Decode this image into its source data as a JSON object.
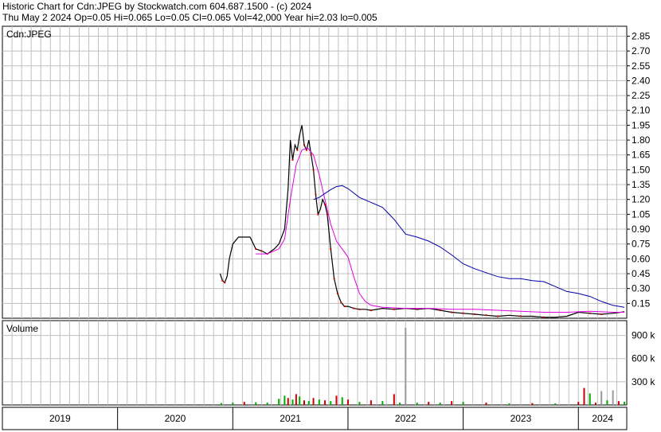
{
  "header": {
    "title_line": "Historic Chart for Cdn:JPEG by Stockwatch.com 604.687.1500 - (c) 2024",
    "quote_line": "Thu May  2 2024  Op=0.05  Hi=0.065  Lo=0.05  Cl=0.065  Vol=42,000  Year hi=2.03  lo=0.005"
  },
  "colors": {
    "price": "#000000",
    "price_down": "#cc0000",
    "ma_short": "#e000e0",
    "ma_long": "#0000aa",
    "volume_up": "#00aa00",
    "volume_down": "#cc0000",
    "volume_neutral": "#999999",
    "grid": "#bfbfbf"
  },
  "chart_data": [
    {
      "type": "line",
      "panel_label": "Cdn:JPEG",
      "x_range": [
        2019.0,
        2024.42
      ],
      "ylim": [
        0.0,
        2.95
      ],
      "y_ticks": [
        "0.15",
        "0.30",
        "0.45",
        "0.60",
        "0.75",
        "0.90",
        "1.05",
        "1.20",
        "1.35",
        "1.50",
        "1.65",
        "1.80",
        "1.95",
        "2.10",
        "2.25",
        "2.40",
        "2.55",
        "2.70",
        "2.85"
      ],
      "x_tick_labels": [
        "2019",
        "2020",
        "2021",
        "2022",
        "2023",
        "2024"
      ],
      "grid": true,
      "series": [
        {
          "role": "price",
          "x": [
            2020.89,
            2020.91,
            2020.93,
            2020.95,
            2020.97,
            2021.0,
            2021.05,
            2021.1,
            2021.15,
            2021.2,
            2021.25,
            2021.3,
            2021.36,
            2021.4,
            2021.45,
            2021.48,
            2021.5,
            2021.52,
            2021.54,
            2021.56,
            2021.58,
            2021.6,
            2021.62,
            2021.64,
            2021.66,
            2021.68,
            2021.7,
            2021.72,
            2021.74,
            2021.76,
            2021.78,
            2021.8,
            2021.82,
            2021.85,
            2021.88,
            2021.91,
            2021.94,
            2021.97,
            2022.0,
            2022.05,
            2022.1,
            2022.15,
            2022.2,
            2022.3,
            2022.4,
            2022.5,
            2022.6,
            2022.7,
            2022.8,
            2022.9,
            2023.0,
            2023.1,
            2023.2,
            2023.3,
            2023.4,
            2023.5,
            2023.6,
            2023.7,
            2023.8,
            2023.9,
            2024.0,
            2024.1,
            2024.2,
            2024.3,
            2024.4
          ],
          "y": [
            0.45,
            0.38,
            0.36,
            0.42,
            0.6,
            0.75,
            0.82,
            0.82,
            0.82,
            0.7,
            0.68,
            0.65,
            0.7,
            0.75,
            0.9,
            1.3,
            1.8,
            1.6,
            1.75,
            1.7,
            1.85,
            1.95,
            1.75,
            1.7,
            1.8,
            1.65,
            1.5,
            1.25,
            1.05,
            1.1,
            1.2,
            1.15,
            1.05,
            0.7,
            0.4,
            0.25,
            0.16,
            0.12,
            0.12,
            0.1,
            0.09,
            0.09,
            0.08,
            0.1,
            0.09,
            0.1,
            0.09,
            0.1,
            0.08,
            0.06,
            0.05,
            0.04,
            0.03,
            0.02,
            0.03,
            0.02,
            0.02,
            0.01,
            0.01,
            0.02,
            0.06,
            0.05,
            0.04,
            0.05,
            0.065
          ]
        },
        {
          "role": "moving-average-short",
          "x": [
            2021.2,
            2021.3,
            2021.4,
            2021.45,
            2021.5,
            2021.55,
            2021.6,
            2021.65,
            2021.7,
            2021.75,
            2021.8,
            2021.85,
            2021.9,
            2021.95,
            2022.0,
            2022.05,
            2022.1,
            2022.15,
            2022.2,
            2022.3,
            2022.5,
            2022.7,
            2022.9,
            2023.1,
            2023.3,
            2023.5,
            2023.7,
            2023.9,
            2024.1,
            2024.3,
            2024.4
          ],
          "y": [
            0.65,
            0.65,
            0.7,
            0.8,
            1.2,
            1.55,
            1.7,
            1.72,
            1.65,
            1.45,
            1.2,
            0.95,
            0.78,
            0.7,
            0.62,
            0.42,
            0.25,
            0.17,
            0.13,
            0.11,
            0.1,
            0.1,
            0.09,
            0.09,
            0.08,
            0.07,
            0.06,
            0.06,
            0.07,
            0.06,
            0.06
          ]
        },
        {
          "role": "moving-average-long",
          "x": [
            2021.7,
            2021.75,
            2021.8,
            2021.85,
            2021.9,
            2021.95,
            2022.0,
            2022.1,
            2022.2,
            2022.3,
            2022.4,
            2022.5,
            2022.6,
            2022.7,
            2022.8,
            2022.9,
            2023.0,
            2023.1,
            2023.2,
            2023.3,
            2023.4,
            2023.5,
            2023.6,
            2023.7,
            2023.8,
            2023.9,
            2024.0,
            2024.1,
            2024.2,
            2024.3,
            2024.4
          ],
          "y": [
            1.2,
            1.22,
            1.26,
            1.3,
            1.33,
            1.34,
            1.31,
            1.22,
            1.17,
            1.12,
            1.0,
            0.85,
            0.82,
            0.78,
            0.72,
            0.64,
            0.55,
            0.5,
            0.46,
            0.42,
            0.4,
            0.4,
            0.38,
            0.37,
            0.32,
            0.27,
            0.25,
            0.22,
            0.17,
            0.13,
            0.11
          ]
        }
      ]
    },
    {
      "type": "bar",
      "panel_label": "Volume",
      "ylim": [
        0,
        1050000
      ],
      "y_ticks": [
        "300 k",
        "600 k",
        "900 k"
      ],
      "tick_values": [
        300000,
        600000,
        900000
      ],
      "x": [
        2020.9,
        2021.0,
        2021.1,
        2021.2,
        2021.3,
        2021.4,
        2021.45,
        2021.48,
        2021.52,
        2021.55,
        2021.58,
        2021.62,
        2021.66,
        2021.7,
        2021.75,
        2021.8,
        2021.85,
        2021.9,
        2021.95,
        2022.0,
        2022.1,
        2022.2,
        2022.3,
        2022.4,
        2022.45,
        2022.5,
        2022.6,
        2022.7,
        2022.8,
        2022.9,
        2023.0,
        2023.2,
        2023.4,
        2023.6,
        2023.8,
        2024.0,
        2024.05,
        2024.1,
        2024.15,
        2024.2,
        2024.25,
        2024.3,
        2024.35,
        2024.4
      ],
      "values": [
        25000,
        30000,
        40000,
        35000,
        30000,
        80000,
        120000,
        90000,
        70000,
        140000,
        110000,
        60000,
        50000,
        90000,
        70000,
        60000,
        50000,
        120000,
        100000,
        70000,
        40000,
        60000,
        50000,
        140000,
        30000,
        1000000,
        30000,
        40000,
        30000,
        50000,
        40000,
        30000,
        20000,
        25000,
        20000,
        40000,
        220000,
        150000,
        30000,
        180000,
        60000,
        190000,
        50000,
        42000
      ],
      "direction": [
        "up",
        "up",
        "down",
        "up",
        "up",
        "up",
        "up",
        "down",
        "up",
        "down",
        "up",
        "down",
        "up",
        "down",
        "up",
        "down",
        "up",
        "down",
        "up",
        "down",
        "up",
        "down",
        "up",
        "down",
        "up",
        "neutral",
        "up",
        "down",
        "up",
        "down",
        "up",
        "down",
        "up",
        "down",
        "up",
        "down",
        "down",
        "up",
        "down",
        "neutral",
        "up",
        "neutral",
        "down",
        "up"
      ]
    }
  ]
}
